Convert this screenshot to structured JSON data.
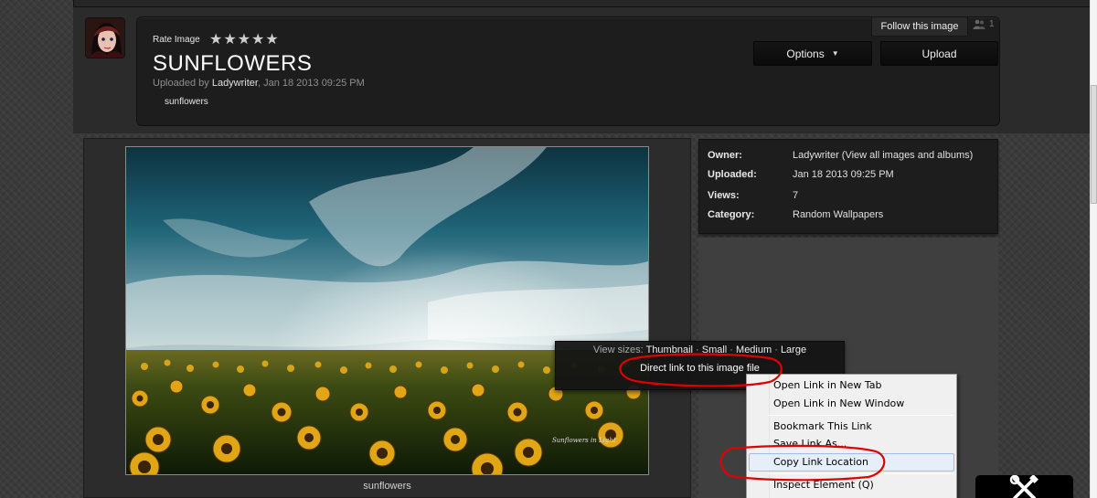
{
  "header": {
    "rate_label": "Rate Image",
    "stars": [
      "★",
      "★",
      "★",
      "★",
      "★"
    ],
    "title": "SUNFLOWERS",
    "uploaded_prefix": "Uploaded by ",
    "uploader": "Ladywriter",
    "uploaded_suffix": ", Jan 18 2013 09:25 PM",
    "tag": "sunflowers",
    "follow_label": "Follow this image",
    "follow_count": "1",
    "options_label": "Options",
    "upload_label": "Upload"
  },
  "image": {
    "caption": "sunflowers",
    "watermark": "Sunflowers in Light"
  },
  "details": [
    {
      "label": "Owner:",
      "value": "Ladywriter (View all images and albums)"
    },
    {
      "label": "Uploaded:",
      "value": "Jan 18 2013 09:25 PM"
    },
    {
      "label": "Views:",
      "value": "7"
    },
    {
      "label": "Category:",
      "value": "Random Wallpapers"
    }
  ],
  "view_sizes": {
    "prefix": "View sizes: ",
    "thumbnail": "Thumbnail",
    "sep": " · ",
    "small": "Small",
    "medium": "Medium",
    "large": "Large",
    "direct_link": "Direct link to this image file"
  },
  "context_menu": {
    "items": [
      "Open Link in New Tab",
      "Open Link in New Window",
      "Bookmark This Link",
      "Save Link As...",
      "Copy Link Location",
      "Inspect Element (Q)"
    ],
    "highlighted": "Copy Link Location"
  },
  "annotation_color": "#e00000",
  "icons": [
    "avatar",
    "star-icon",
    "users-icon",
    "caret-down-icon",
    "tools-icon"
  ]
}
